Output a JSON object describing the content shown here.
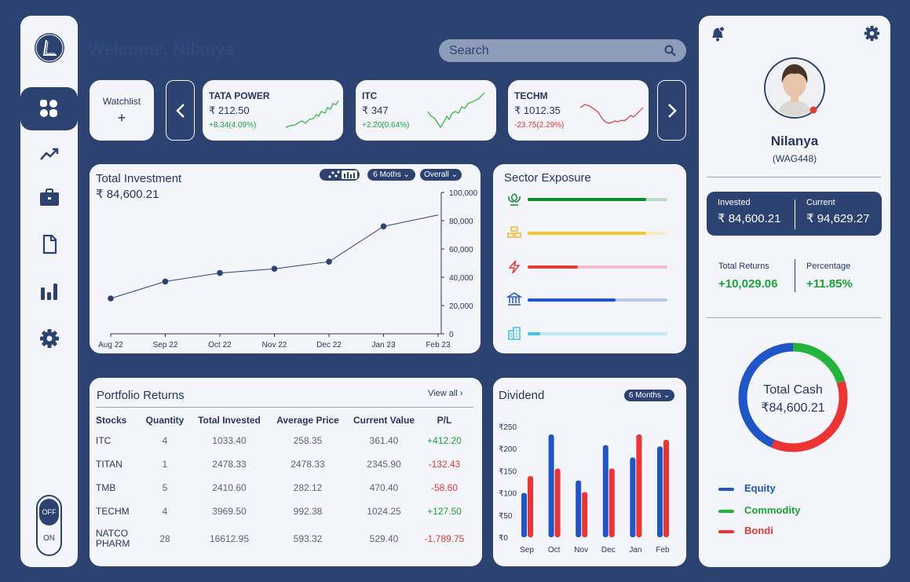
{
  "header": {
    "welcome": "Welcome, Nilanya",
    "search_placeholder": "Search"
  },
  "sidebar": {
    "items": [
      {
        "icon": "dashboard-icon",
        "active": true
      },
      {
        "icon": "trending-icon"
      },
      {
        "icon": "briefcase-icon"
      },
      {
        "icon": "document-icon"
      },
      {
        "icon": "bar-chart-icon"
      },
      {
        "icon": "settings-icon"
      }
    ],
    "toggle": {
      "off": "OFF",
      "on": "ON"
    }
  },
  "watchlist": {
    "label": "Watchlist",
    "add": "+",
    "stocks": [
      {
        "name": "TATA POWER",
        "price": "₹ 212.50",
        "change": "+8.34(4.09%)",
        "trend": "up"
      },
      {
        "name": "ITC",
        "price": "₹ 347",
        "change": "+2.20(0.64%)",
        "trend": "up"
      },
      {
        "name": "TECHM",
        "price": "₹ 1012.35",
        "change": "-23.75(2.29%)",
        "trend": "down"
      }
    ]
  },
  "investment": {
    "title": "Total Investment",
    "value": "₹ 84,600.21",
    "period": "6 Moths",
    "scope": "Overall"
  },
  "chart_data": {
    "type": "line",
    "categories": [
      "Aug 22",
      "Sep 22",
      "Oct 22",
      "Nov 22",
      "Dec 22",
      "Jan 23",
      "Feb 23"
    ],
    "series": [
      {
        "values": [
          25000,
          37000,
          43000,
          46000,
          51000,
          76000,
          84000
        ]
      }
    ],
    "ylim": [
      0,
      100000
    ],
    "yticks": [
      "100,000",
      "80,000",
      "60,000",
      "40,000",
      "20,000",
      "0"
    ],
    "grid": false
  },
  "sector": {
    "title": "Sector Exposure",
    "items": [
      {
        "icon": "agriculture-icon",
        "fill": 0.85,
        "color": "#0d8a2b",
        "track": "#b9dcc1"
      },
      {
        "icon": "commodity-icon",
        "fill": 0.85,
        "color": "#f6c62a",
        "track": "#fbecc0"
      },
      {
        "icon": "energy-icon",
        "fill": 0.36,
        "color": "#e8383a",
        "track": "#f4bcc2"
      },
      {
        "icon": "bank-icon",
        "fill": 0.63,
        "color": "#1e55c8",
        "track": "#b7c8ea"
      },
      {
        "icon": "building-icon",
        "fill": 0.09,
        "color": "#3bc4e6",
        "track": "#bfe9f4"
      }
    ]
  },
  "returns": {
    "title": "Portfolio Returns",
    "view_all": "View all",
    "columns": [
      "Stocks",
      "Quantity",
      "Total Invested",
      "Average Price",
      "Current Value",
      "P/L"
    ],
    "rows": [
      {
        "stock": "ITC",
        "qty": "4",
        "invested": "1033.40",
        "avg": "258.35",
        "current": "361.40",
        "pl": "+412.20",
        "up": true
      },
      {
        "stock": "TITAN",
        "qty": "1",
        "invested": "2478.33",
        "avg": "2478.33",
        "current": "2345.90",
        "pl": "-132.43",
        "up": false
      },
      {
        "stock": "TMB",
        "qty": "5",
        "invested": "2410.60",
        "avg": "282.12",
        "current": "470.40",
        "pl": "-58.60",
        "up": false
      },
      {
        "stock": "TECHM",
        "qty": "4",
        "invested": "3969.50",
        "avg": "992.38",
        "current": "1024.25",
        "pl": "+127.50",
        "up": true
      },
      {
        "stock": "NATCO PHARM",
        "qty": "28",
        "invested": "16612.95",
        "avg": "593.32",
        "current": "529.40",
        "pl": "-1,789.75",
        "up": false
      }
    ]
  },
  "dividend": {
    "title": "Dividend",
    "period": "6 Months",
    "yticks": [
      "₹250",
      "₹200",
      "₹150",
      "₹100",
      "₹50",
      "₹0"
    ],
    "categories": [
      "Sep",
      "Oct",
      "Nov",
      "Dec",
      "Jan",
      "Feb"
    ],
    "blue": [
      100,
      232,
      128,
      208,
      180,
      205
    ],
    "red": [
      138,
      155,
      102,
      155,
      232,
      220
    ],
    "ymax": 250
  },
  "profile": {
    "name": "Nilanya",
    "id": "(WAG448)",
    "invested_label": "Invested",
    "invested": "₹ 84,600.21",
    "current_label": "Current",
    "current": "₹ 94,629.27",
    "returns_label": "Total Returns",
    "returns": "+10,029.06",
    "pct_label": "Percentage",
    "pct": "+11.85%"
  },
  "cash": {
    "label": "Total Cash",
    "value": "₹84,600.21",
    "segments": [
      {
        "name": "Equity",
        "color": "#1e55c8",
        "fraction": 0.435
      },
      {
        "name": "Commodity",
        "color": "#22b53a",
        "fraction": 0.2
      },
      {
        "name": "Bondi",
        "color": "#ee3432",
        "fraction": 0.365
      }
    ]
  },
  "colors": {
    "navy": "#2c4371",
    "green": "#1aa635",
    "red": "#e53935",
    "card": "#f3f5fa"
  }
}
